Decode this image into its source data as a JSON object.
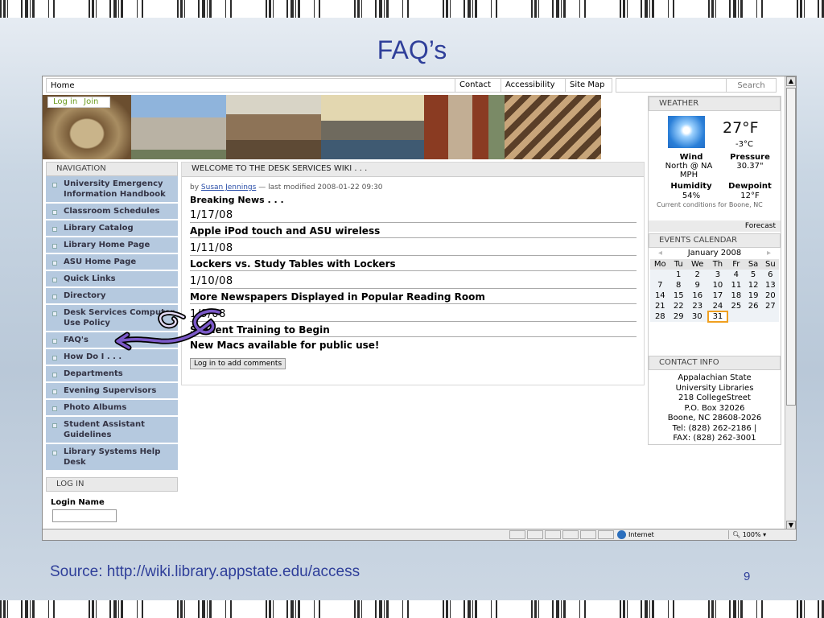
{
  "slide": {
    "title": "FAQ’s",
    "source": "Source: http://wiki.library.appstate.edu/access",
    "page_number": "9"
  },
  "topnav": {
    "home": "Home",
    "links": [
      "Contact",
      "Accessibility",
      "Site Map"
    ],
    "search_placeholder": "Search"
  },
  "auth": {
    "login": "Log in",
    "join": "Join"
  },
  "navigation": {
    "header": "NAVIGATION",
    "items": [
      "University Emergency Information Handbook",
      "Classroom Schedules",
      "Library Catalog",
      "Library Home Page",
      "ASU Home Page",
      "Quick Links",
      "Directory",
      "Desk Services Computer Use Policy",
      "FAQ's",
      "How Do I . . .",
      "Departments",
      "Evening Supervisors",
      "Photo Albums",
      "Student Assistant Guidelines",
      "Library Systems Help Desk"
    ]
  },
  "login": {
    "header": "LOG IN",
    "label": "Login Name"
  },
  "main": {
    "header": "WELCOME TO THE DESK SERVICES WIKI . . .",
    "byline_prefix": "by",
    "author": "Susan Jennings",
    "modified": "— last modified 2008-01-22 09:30",
    "breaking": "Breaking News . . .",
    "entries": [
      {
        "date": "1/17/08",
        "title": "Apple iPod touch and ASU wireless"
      },
      {
        "date": "1/11/08",
        "title": "Lockers vs. Study Tables with Lockers"
      },
      {
        "date": "1/10/08",
        "title": "More Newspapers Displayed in Popular Reading Room"
      },
      {
        "date": "1/9/08",
        "title": "Student Training to Begin"
      }
    ],
    "last_post": "New Macs available for public use!",
    "comment_button": "Log in to add comments"
  },
  "weather": {
    "header": "WEATHER",
    "temp_f": "27°F",
    "temp_c": "-3°C",
    "wind_label": "Wind",
    "wind_value": "North @ NA MPH",
    "pressure_label": "Pressure",
    "pressure_value": "30.37\"",
    "humidity_label": "Humidity",
    "humidity_value": "54%",
    "dewpoint_label": "Dewpoint",
    "dewpoint_value": "12°F",
    "note": "Current conditions for Boone, NC",
    "forecast": "Forecast"
  },
  "calendar": {
    "header": "EVENTS CALENDAR",
    "month": "January 2008",
    "prev": "◂",
    "next": "▸",
    "weekdays": [
      "Mo",
      "Tu",
      "We",
      "Th",
      "Fr",
      "Sa",
      "Su"
    ],
    "weeks": [
      [
        "",
        "1",
        "2",
        "3",
        "4",
        "5",
        "6"
      ],
      [
        "7",
        "8",
        "9",
        "10",
        "11",
        "12",
        "13"
      ],
      [
        "14",
        "15",
        "16",
        "17",
        "18",
        "19",
        "20"
      ],
      [
        "21",
        "22",
        "23",
        "24",
        "25",
        "26",
        "27"
      ],
      [
        "28",
        "29",
        "30",
        "31",
        "",
        "",
        ""
      ]
    ],
    "today": "31"
  },
  "contact": {
    "header": "CONTACT INFO",
    "lines": [
      "Appalachian State",
      "University Libraries",
      "218 CollegeStreet",
      "P.O. Box 32026",
      "Boone, NC 28608-2026",
      "Tel: (828) 262-2186 |",
      "FAX: (828) 262-3001"
    ]
  },
  "statusbar": {
    "zone": "Internet",
    "zoom": "100%"
  },
  "colors": {
    "title": "#2f3f9a",
    "nav_item": "#b5c9df",
    "link_green": "#6a9a1e",
    "today": "#f0a020"
  }
}
